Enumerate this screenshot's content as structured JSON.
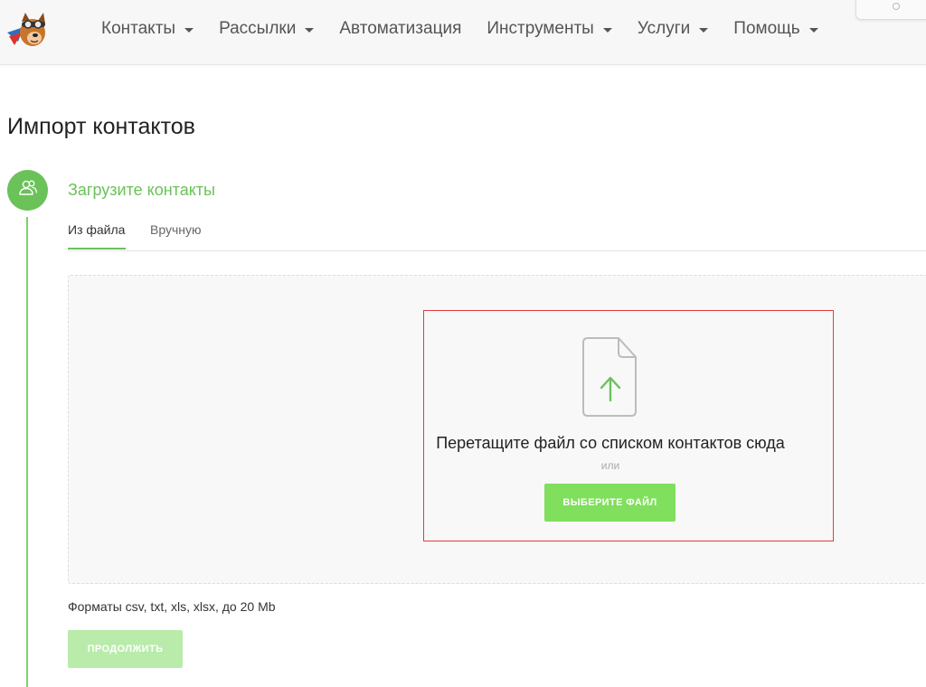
{
  "nav": {
    "items": [
      {
        "label": "Контакты",
        "has_dropdown": true
      },
      {
        "label": "Рассылки",
        "has_dropdown": true
      },
      {
        "label": "Автоматизация",
        "has_dropdown": false
      },
      {
        "label": "Инструменты",
        "has_dropdown": true
      },
      {
        "label": "Услуги",
        "has_dropdown": true
      },
      {
        "label": "Помощь",
        "has_dropdown": true
      }
    ]
  },
  "page": {
    "title": "Импорт контактов"
  },
  "step": {
    "icon": "users-icon",
    "title": "Загрузите контакты"
  },
  "tabs": [
    {
      "label": "Из файла",
      "active": true
    },
    {
      "label": "Вручную",
      "active": false
    }
  ],
  "dropzone": {
    "icon": "file-upload-icon",
    "instruction": "Перетащите файл со списком контактов сюда",
    "or_text": "или",
    "choose_button": "ВЫБЕРИТЕ ФАЙЛ"
  },
  "formats_note": "Форматы csv, txt, xls, xlsx, до 20 Mb",
  "continue_button": "ПРОДОЛЖИТЬ",
  "colors": {
    "accent": "#6ac259",
    "button_green": "#80df5c",
    "button_disabled": "#b9ebaa",
    "highlight_border": "#e03c3c"
  }
}
